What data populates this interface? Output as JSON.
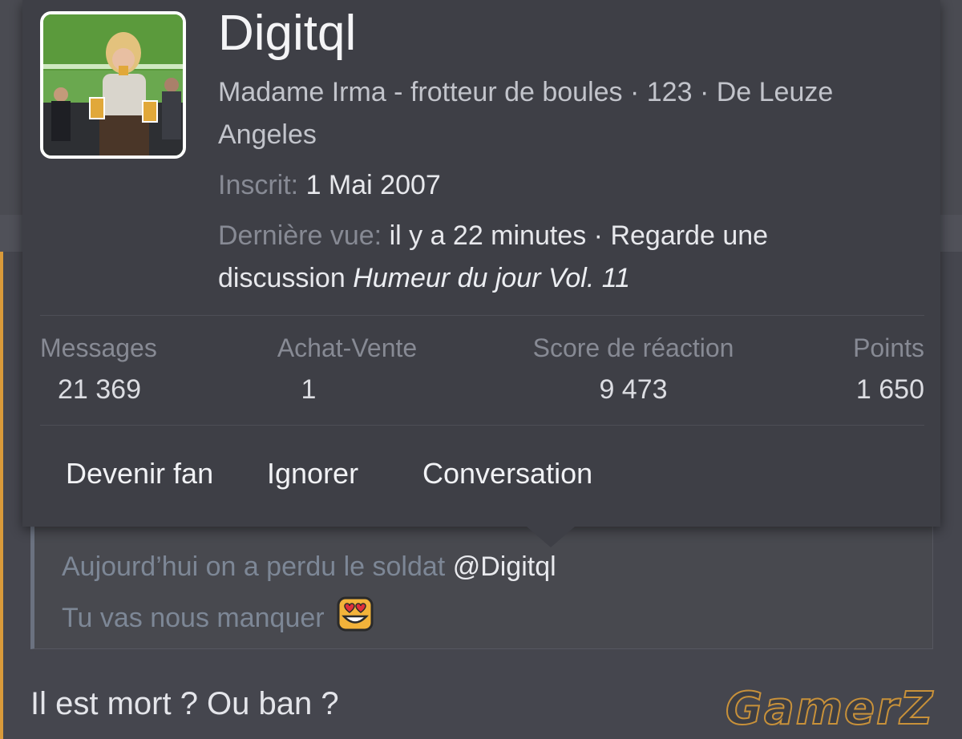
{
  "card": {
    "username": "Digitql",
    "title_line1": "Madame Irma - frotteur de boules · 123 · De Leuze",
    "title_line2": "Angeles",
    "joined_label": "Inscrit:",
    "joined_value": "1 Mai 2007",
    "last_seen_label": "Dernière vue:",
    "last_seen_value": "il y a 22 minutes · Regarde une",
    "activity_prefix": "discussion",
    "activity_thread": "Humeur du jour Vol. 11",
    "stats": [
      {
        "label": "Messages",
        "value": "21 369"
      },
      {
        "label": "Achat-Vente",
        "value": "1"
      },
      {
        "label": "Score de réaction",
        "value": "9 473"
      },
      {
        "label": "Points",
        "value": "1 650"
      }
    ],
    "actions": {
      "follow": "Devenir fan",
      "ignore": "Ignorer",
      "conversation": "Conversation"
    }
  },
  "quote": {
    "line1_text": "Aujourd’hui on a perdu le soldat",
    "mention": "@Digitql",
    "line2_text": "Tu vas nous manquer",
    "emoji": "heart-eyes-emoji"
  },
  "post": {
    "text": "Il est mort ? Ou ban ?"
  },
  "watermark": {
    "text": "GamerZ"
  },
  "colors": {
    "accent": "#d99a3a",
    "card_bg": "#3e3f46",
    "page_bg": "#45464e",
    "quote_border": "#6b7280"
  }
}
